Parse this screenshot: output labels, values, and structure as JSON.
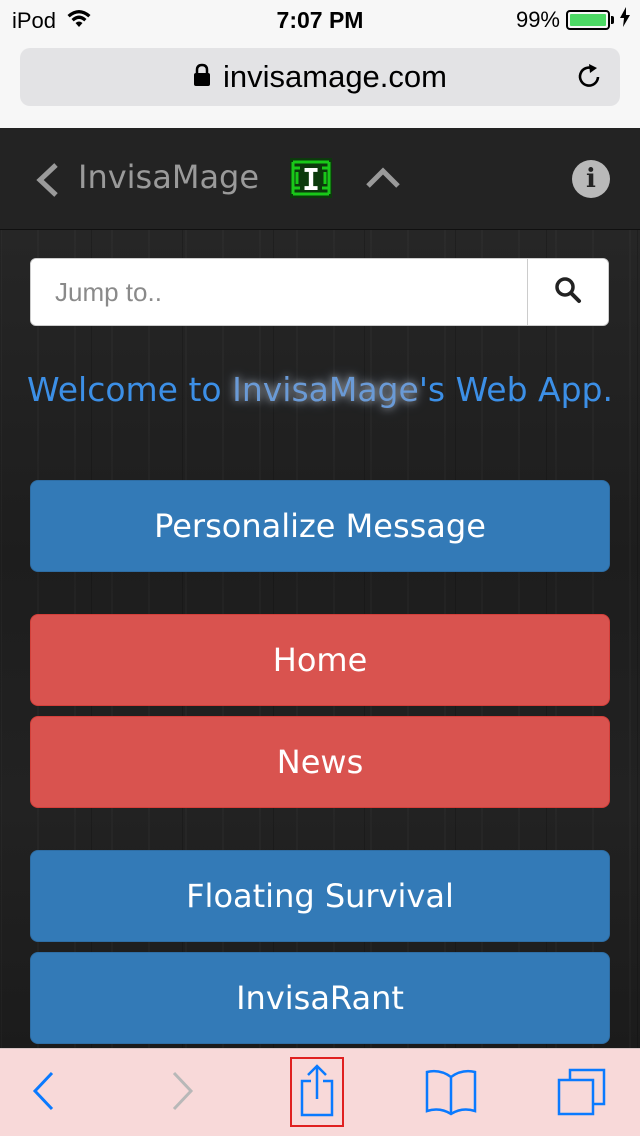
{
  "status_bar": {
    "carrier": "iPod",
    "time": "7:07 PM",
    "battery": "99%",
    "battery_level": 0.99
  },
  "browser": {
    "url": "invisamage.com"
  },
  "app_header": {
    "brand": "InvisaMage",
    "logo_letter": "I"
  },
  "search": {
    "placeholder": "Jump to.."
  },
  "welcome": {
    "prefix": "Welcome to ",
    "highlight": "InvisaMage",
    "suffix": "'s Web App."
  },
  "buttons": [
    {
      "label": "Personalize Message",
      "color": "#337ab7"
    },
    {
      "label": "Home",
      "color": "#d9534f"
    },
    {
      "label": "News",
      "color": "#d9534f"
    },
    {
      "label": "Floating Survival",
      "color": "#337ab7"
    },
    {
      "label": "InvisaRant",
      "color": "#337ab7"
    }
  ],
  "colors": {
    "accent": "#0a7aff",
    "welcome": "#3c8fe6",
    "logo_green": "#19c819"
  },
  "icons": [
    "wifi-icon",
    "lock-icon",
    "reload-icon",
    "back-chevron-icon",
    "up-chevron-icon",
    "info-icon",
    "search-icon",
    "toolbar-back-icon",
    "toolbar-forward-icon",
    "share-icon",
    "bookmarks-icon",
    "tabs-icon"
  ]
}
